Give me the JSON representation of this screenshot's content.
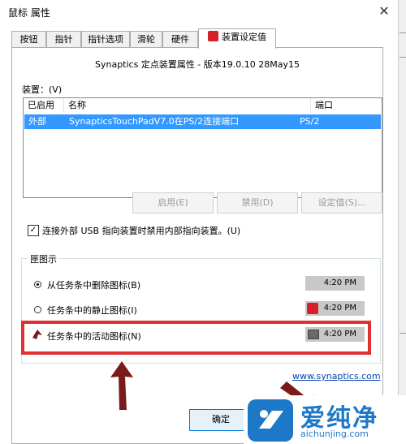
{
  "window": {
    "title": "鼠标 属性",
    "close_glyph": "✕"
  },
  "tabs": [
    {
      "label": "按钮"
    },
    {
      "label": "指针"
    },
    {
      "label": "指针选项"
    },
    {
      "label": "滑轮"
    },
    {
      "label": "硬件"
    },
    {
      "label": "装置设定值",
      "icon": "synaptics-icon",
      "active": true
    }
  ],
  "device_settings": {
    "title": "Synaptics 定点装置属性 - 版本19.0.10 28May15",
    "devices_label": "装置：(V)",
    "columns": [
      "已启用",
      "名称",
      "端口"
    ],
    "rows": [
      {
        "enabled": "外部",
        "name": "SynapticsTouchPadV7.0在PS/2连接端口",
        "port": "PS/2",
        "selected": true
      }
    ],
    "buttons": {
      "enable": "启用(E)",
      "disable": "禁用(D)",
      "settings": "设定值(S)..."
    },
    "checkbox": {
      "label": "连接外部 USB 指向装置时禁用内部指向装置。(U)",
      "checked": true,
      "mark": "✓"
    }
  },
  "tray_icon_group": {
    "label": "匣图示",
    "options": [
      {
        "label": "从任务条中删除图标(B)",
        "selected": true,
        "time": "4:20 PM",
        "icon": "none"
      },
      {
        "label": "任务条中的静止图标(I)",
        "selected": false,
        "time": "4:20 PM",
        "icon": "synaptics-icon"
      },
      {
        "label": "任务条中的活动图标(N)",
        "selected": false,
        "time": "4:20 PM",
        "icon": "touchpad-icon"
      }
    ]
  },
  "website": "www.synaptics.com",
  "ok_button": "确定",
  "watermark": {
    "title": "爱纯净",
    "url": "aichunjing.com"
  },
  "colors": {
    "highlight_box": "#e0302f",
    "selection": "#3399ff",
    "arrow": "#7a1a1a",
    "link": "#0645ad",
    "watermark": "#1e78c8"
  }
}
